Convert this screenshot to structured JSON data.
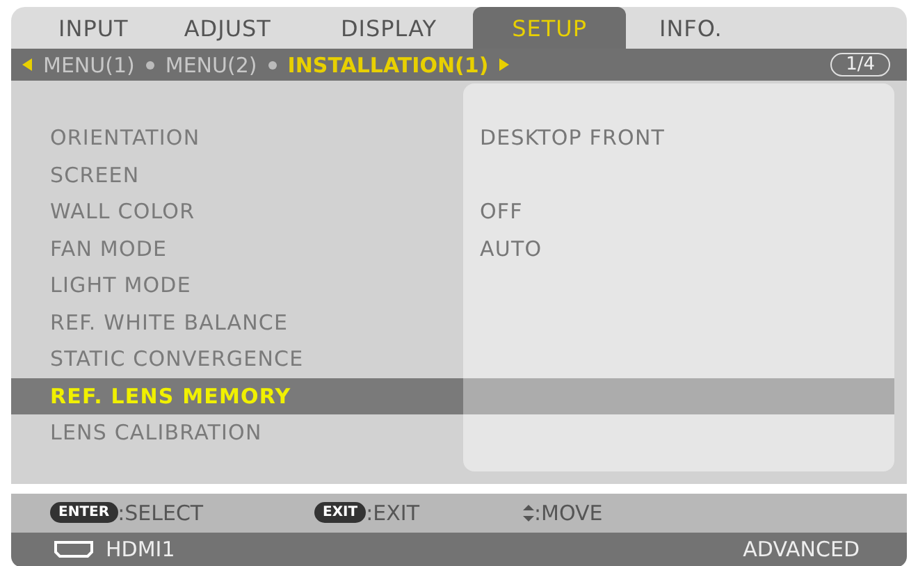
{
  "tabs": [
    {
      "label": "INPUT",
      "selected": false
    },
    {
      "label": "ADJUST",
      "selected": false
    },
    {
      "label": "DISPLAY",
      "selected": false
    },
    {
      "label": "SETUP",
      "selected": true
    },
    {
      "label": "INFO.",
      "selected": false
    }
  ],
  "breadcrumb": {
    "items": [
      {
        "label": "MENU(1)",
        "selected": false
      },
      {
        "label": "MENU(2)",
        "selected": false
      },
      {
        "label": "INSTALLATION(1)",
        "selected": true
      }
    ],
    "page": "1/4"
  },
  "rows": [
    {
      "label": "ORIENTATION",
      "value": "DESKTOP FRONT",
      "selected": false
    },
    {
      "label": "SCREEN",
      "selected": false
    },
    {
      "label": "WALL COLOR",
      "value": "OFF",
      "selected": false
    },
    {
      "label": "FAN MODE",
      "value": "AUTO",
      "selected": false
    },
    {
      "label": "LIGHT MODE",
      "selected": false
    },
    {
      "label": "REF. WHITE BALANCE",
      "selected": false
    },
    {
      "label": "STATIC CONVERGENCE",
      "selected": false
    },
    {
      "label": "REF. LENS MEMORY",
      "selected": true
    },
    {
      "label": "LENS CALIBRATION",
      "selected": false
    }
  ],
  "help": [
    {
      "kind": "key",
      "key": "ENTER",
      "label": ":SELECT"
    },
    {
      "kind": "key",
      "key": "EXIT",
      "label": ":EXIT"
    },
    {
      "kind": "move",
      "label": ":MOVE"
    }
  ],
  "status": {
    "source": "HDMI1",
    "mode": "ADVANCED"
  }
}
